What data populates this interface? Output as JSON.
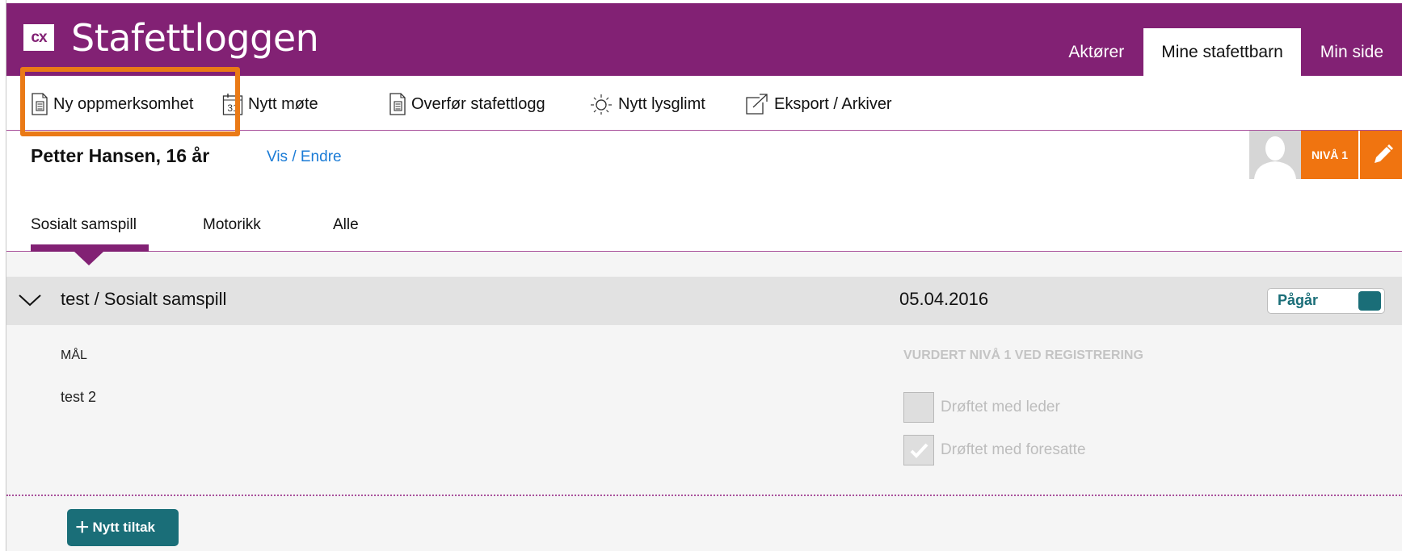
{
  "header": {
    "logo_text": "cx",
    "app_title": "Stafettloggen",
    "nav": [
      {
        "label": "Aktører"
      },
      {
        "label": "Mine stafettbarn"
      },
      {
        "label": "Min side"
      }
    ]
  },
  "toolbar": {
    "items": [
      {
        "label": "Ny oppmerksomhet",
        "icon": "document-icon"
      },
      {
        "label": "Nytt møte",
        "icon": "calendar-icon",
        "icon_text": "31"
      },
      {
        "label": "Overfør stafettlogg",
        "icon": "document-icon"
      },
      {
        "label": "Nytt lysglimt",
        "icon": "sun-icon"
      },
      {
        "label": "Eksport / Arkiver",
        "icon": "export-icon"
      }
    ],
    "highlight_color": "#ea7a16"
  },
  "person": {
    "name": "Petter Hansen, 16 år",
    "view_edit_link": "Vis / Endre",
    "level_badge": "NIVÅ 1"
  },
  "tabs": [
    {
      "label": "Sosialt samspill",
      "active": true
    },
    {
      "label": "Motorikk",
      "active": false
    },
    {
      "label": "Alle",
      "active": false
    }
  ],
  "item": {
    "title": "test / Sosialt samspill",
    "date": "05.04.2016",
    "status": "Pågår",
    "goal_label": "MÅL",
    "goal_value": "test 2",
    "assessment_label": "VURDERT NIVÅ 1 VED REGISTRERING",
    "checks": [
      {
        "label": "Drøftet med leder",
        "checked": false
      },
      {
        "label": "Drøftet med foresatte",
        "checked": true
      }
    ],
    "add_action_label": "Nytt tiltak"
  },
  "colors": {
    "brand": "#822174",
    "accent_orange": "#f07410",
    "teal": "#1a6e78",
    "link": "#1a7bd6"
  }
}
